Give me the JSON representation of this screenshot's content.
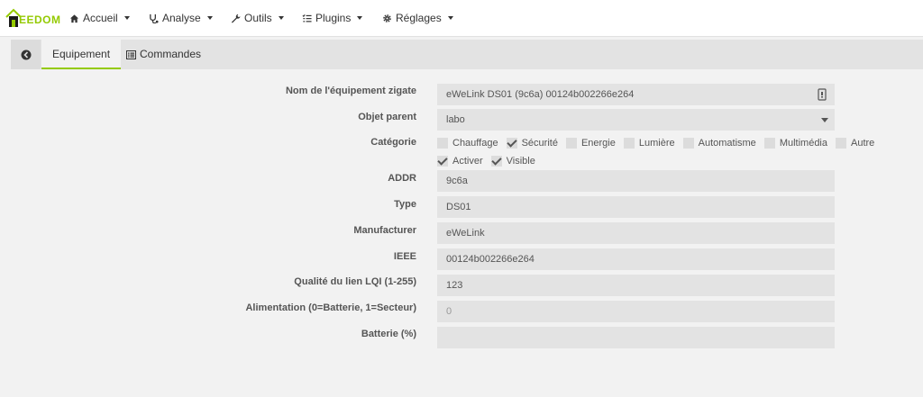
{
  "navbar": {
    "logo_text": "EEDOM",
    "items": [
      {
        "label": "Accueil",
        "icon": "home-icon"
      },
      {
        "label": "Analyse",
        "icon": "stethoscope-icon"
      },
      {
        "label": "Outils",
        "icon": "wrench-icon"
      },
      {
        "label": "Plugins",
        "icon": "tasks-icon"
      },
      {
        "label": "Réglages",
        "icon": "cog-icon"
      }
    ]
  },
  "tabs": {
    "back_icon": "arrow-circle-left-icon",
    "equipment": "Equipement",
    "commands": "Commandes",
    "commands_icon": "list-alt-icon"
  },
  "form": {
    "name_label": "Nom de l'équipement zigate",
    "name_value": "eWeLink DS01 (9c6a) 00124b002266e264",
    "parent_label": "Objet parent",
    "parent_value": "labo",
    "category_label": "Catégorie",
    "categories": [
      {
        "label": "Chauffage",
        "checked": false
      },
      {
        "label": "Sécurité",
        "checked": true
      },
      {
        "label": "Energie",
        "checked": false
      },
      {
        "label": "Lumière",
        "checked": false
      },
      {
        "label": "Automatisme",
        "checked": false
      },
      {
        "label": "Multimédia",
        "checked": false
      },
      {
        "label": "Autre",
        "checked": false
      }
    ],
    "options": [
      {
        "label": "Activer",
        "checked": true
      },
      {
        "label": "Visible",
        "checked": true
      }
    ],
    "addr_label": "ADDR",
    "addr_value": "9c6a",
    "type_label": "Type",
    "type_value": "DS01",
    "manufacturer_label": "Manufacturer",
    "manufacturer_value": "eWeLink",
    "ieee_label": "IEEE",
    "ieee_value": "00124b002266e264",
    "lqi_label": "Qualité du lien LQI (1-255)",
    "lqi_value": "123",
    "power_label": "Alimentation (0=Batterie, 1=Secteur)",
    "power_placeholder": "0",
    "battery_label": "Batterie (%)",
    "battery_value": ""
  }
}
